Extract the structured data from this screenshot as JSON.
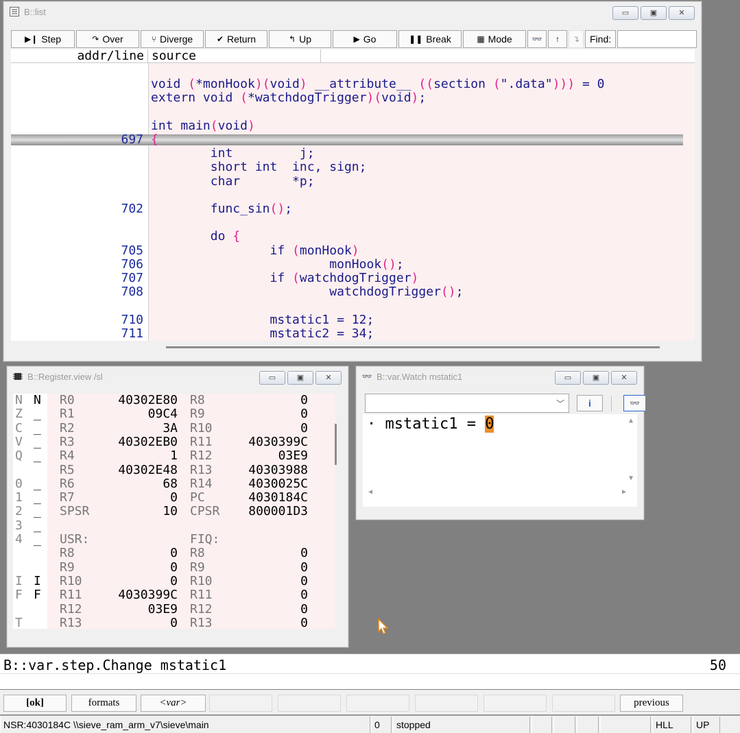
{
  "list_window": {
    "title": "B::list",
    "toolbar": {
      "step": "Step",
      "over": "Over",
      "diverge": "Diverge",
      "return": "Return",
      "up": "Up",
      "go": "Go",
      "break": "Break",
      "mode": "Mode",
      "find_label": "Find:"
    },
    "columns": {
      "addr": "addr/line",
      "source": "source"
    },
    "rows": [
      {
        "line": "",
        "code": ""
      },
      {
        "line": "",
        "code": "void (*monHook)(void) __attribute__ ((section (\".data\"))) = 0"
      },
      {
        "line": "",
        "code": "extern void (*watchdogTrigger)(void);"
      },
      {
        "line": "",
        "code": ""
      },
      {
        "line": "",
        "code": "int main(void)"
      },
      {
        "line": "697",
        "code": "{"
      },
      {
        "line": "",
        "code": "        int         j;"
      },
      {
        "line": "",
        "code": "        short int  inc, sign;"
      },
      {
        "line": "",
        "code": "        char       *p;"
      },
      {
        "line": "",
        "code": ""
      },
      {
        "line": "702",
        "code": "        func_sin();"
      },
      {
        "line": "",
        "code": ""
      },
      {
        "line": "",
        "code": "        do {"
      },
      {
        "line": "705",
        "code": "                if (monHook)"
      },
      {
        "line": "706",
        "code": "                        monHook();"
      },
      {
        "line": "707",
        "code": "                if (watchdogTrigger)"
      },
      {
        "line": "708",
        "code": "                        watchdogTrigger();"
      },
      {
        "line": "",
        "code": ""
      },
      {
        "line": "710",
        "code": "                mstatic1 = 12;"
      },
      {
        "line": "711",
        "code": "                mstatic2 = 34;"
      }
    ]
  },
  "register_window": {
    "title": "B::Register.view /sl",
    "rows": [
      {
        "f1": "N",
        "f2": "N",
        "n1": "R0",
        "v1": "40302E80",
        "n2": "R8",
        "v2": "0"
      },
      {
        "f1": "Z",
        "f2": "_",
        "n1": "R1",
        "v1": "09C4",
        "n2": "R9",
        "v2": "0"
      },
      {
        "f1": "C",
        "f2": "_",
        "n1": "R2",
        "v1": "3A",
        "n2": "R10",
        "v2": "0"
      },
      {
        "f1": "V",
        "f2": "_",
        "n1": "R3",
        "v1": "40302EB0",
        "n2": "R11",
        "v2": "4030399C"
      },
      {
        "f1": "Q",
        "f2": "_",
        "n1": "R4",
        "v1": "1",
        "n2": "R12",
        "v2": "03E9"
      },
      {
        "f1": "",
        "f2": "",
        "n1": "R5",
        "v1": "40302E48",
        "n2": "R13",
        "v2": "40303988"
      },
      {
        "f1": "0",
        "f2": "_",
        "n1": "R6",
        "v1": "68",
        "n2": "R14",
        "v2": "4030025C"
      },
      {
        "f1": "1",
        "f2": "_",
        "n1": "R7",
        "v1": "0",
        "n2": "PC",
        "v2": "4030184C"
      },
      {
        "f1": "2",
        "f2": "_",
        "n1": "SPSR",
        "v1": "10",
        "n2": "CPSR",
        "v2": "800001D3"
      },
      {
        "f1": "3",
        "f2": "_",
        "n1": "",
        "v1": "",
        "n2": "",
        "v2": ""
      },
      {
        "f1": "4",
        "f2": "_",
        "n1": "USR:",
        "v1": "",
        "n2": "FIQ:",
        "v2": ""
      },
      {
        "f1": "",
        "f2": "",
        "n1": "R8",
        "v1": "0",
        "n2": "R8",
        "v2": "0"
      },
      {
        "f1": "",
        "f2": "",
        "n1": "R9",
        "v1": "0",
        "n2": "R9",
        "v2": "0"
      },
      {
        "f1": "I",
        "f2": "I",
        "n1": "R10",
        "v1": "0",
        "n2": "R10",
        "v2": "0"
      },
      {
        "f1": "F",
        "f2": "F",
        "n1": "R11",
        "v1": "4030399C",
        "n2": "R11",
        "v2": "0"
      },
      {
        "f1": "",
        "f2": "",
        "n1": "R12",
        "v1": "03E9",
        "n2": "R12",
        "v2": "0"
      },
      {
        "f1": "T",
        "f2": "_",
        "n1": "R13",
        "v1": "0",
        "n2": "R13",
        "v2": "0"
      }
    ]
  },
  "watch_window": {
    "title": "B::var.Watch mstatic1",
    "combo_value": "",
    "entry_prefix": "· mstatic1 = ",
    "entry_value": "0"
  },
  "command_line": {
    "text": "B::var.step.Change mstatic1",
    "count": "50"
  },
  "softkeys": {
    "ok": "[ok]",
    "formats": "formats",
    "var": "<var>",
    "previous": "previous"
  },
  "status_bar": {
    "location": "NSR:4030184C  \\\\sieve_ram_arm_v7\\sieve\\main",
    "counter": "0",
    "state": "stopped",
    "mode": "HLL",
    "up": "UP"
  },
  "colors": {
    "code_bg": "#fdf0f0",
    "keyword": "#1a1a8c",
    "paren": "#e0208c",
    "watch_highlight": "#e8902a"
  }
}
